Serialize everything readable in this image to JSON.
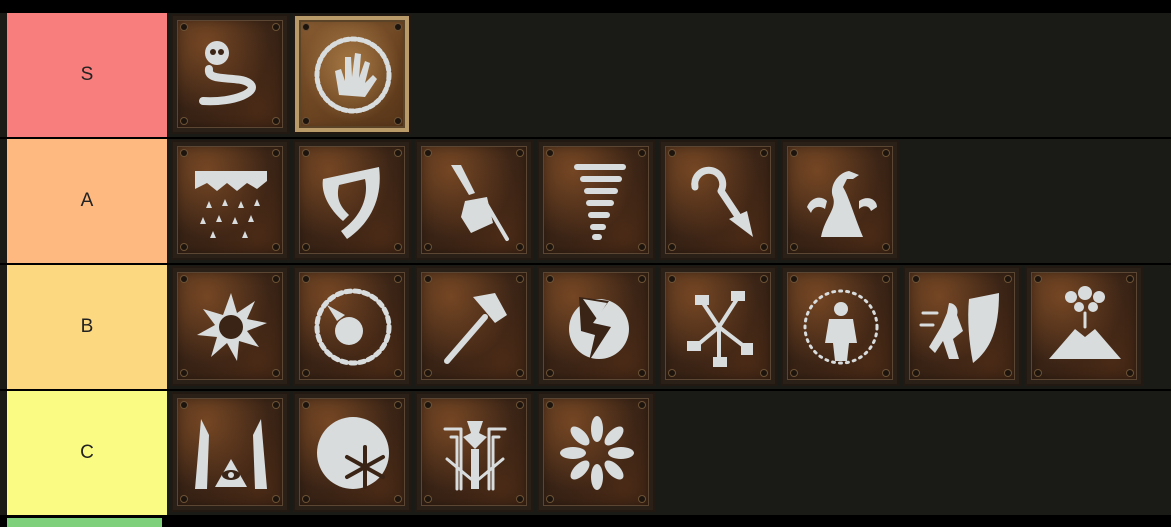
{
  "tiers": [
    {
      "label": "S",
      "color": "#f87d7d",
      "icons": [
        "poison-skull-wisp-icon",
        "flaming-hand-icon"
      ]
    },
    {
      "label": "A",
      "color": "#fdb97f",
      "icons": [
        "ice-shards-rain-icon",
        "claw-shield-icon",
        "hammer-lightning-strike-icon",
        "tornado-icon",
        "leap-arrow-icon",
        "dragon-hydra-icon"
      ]
    },
    {
      "label": "B",
      "color": "#fcd880",
      "icons": [
        "black-sun-icon",
        "fire-orb-icon",
        "hammer-icon",
        "lightning-orb-icon",
        "scattered-hammers-icon",
        "radiant-figure-icon",
        "shield-charge-icon",
        "volcano-icon"
      ]
    },
    {
      "label": "C",
      "color": "#fafb83",
      "icons": [
        "seeing-eye-trees-icon",
        "frost-orb-icon",
        "rune-totem-icon",
        "petal-burst-icon"
      ]
    }
  ],
  "next_tier_color": "#7fd07a"
}
